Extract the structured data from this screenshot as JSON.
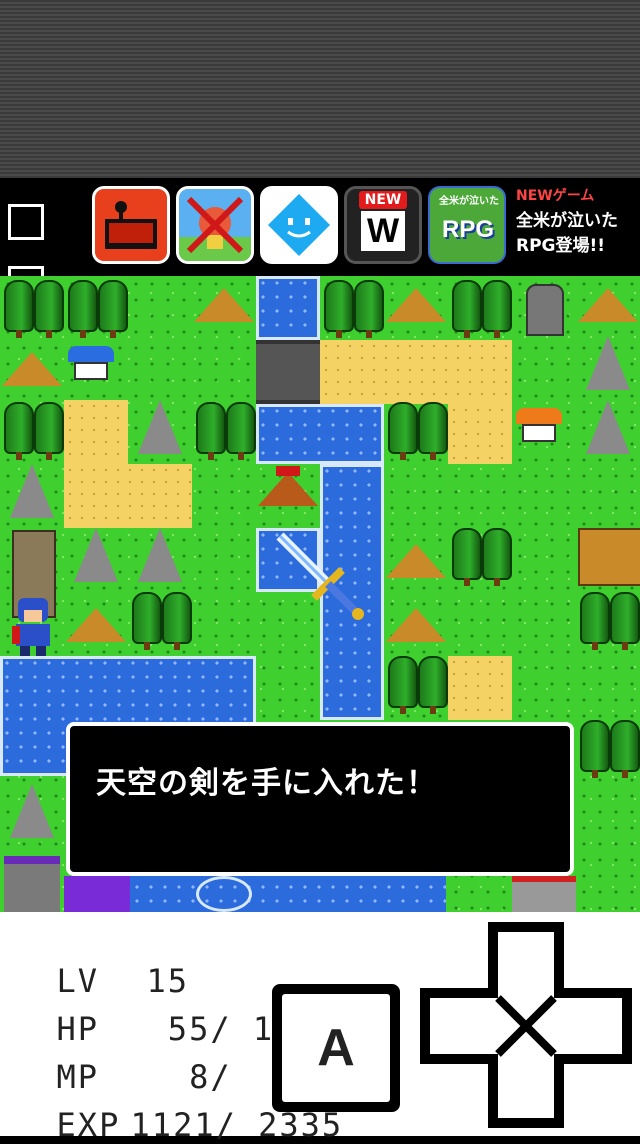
{
  "ads": {
    "icons": [
      {
        "name": "app-icon-cooking",
        "color": "#e8401c"
      },
      {
        "name": "app-icon-no-character",
        "color": "#5ab0f0"
      },
      {
        "name": "app-icon-blue-face",
        "color": "#22aaee"
      },
      {
        "name": "app-icon-new-w",
        "badge": "NEW",
        "letter": "W"
      },
      {
        "name": "app-icon-rpg",
        "caption": "全米が泣いた",
        "label": "RPG"
      }
    ],
    "promo_new": "NEWゲーム",
    "promo_line1": "全米が泣いた",
    "promo_line2": "RPG登場!!"
  },
  "message": {
    "text": "天空の剣を手に入れた！"
  },
  "status": {
    "lv_label": "LV",
    "lv_value": "15",
    "hp_label": "HP",
    "hp_value": " 55/ 108",
    "mp_label": "MP",
    "mp_value": "  8/  26",
    "exp_label": "EXP",
    "exp_value": "1121/ 2335"
  },
  "controls": {
    "a_button": "A"
  },
  "colors": {
    "grass": "#3fcf2f",
    "water": "#2c6bdb",
    "sand": "#f4d264"
  }
}
